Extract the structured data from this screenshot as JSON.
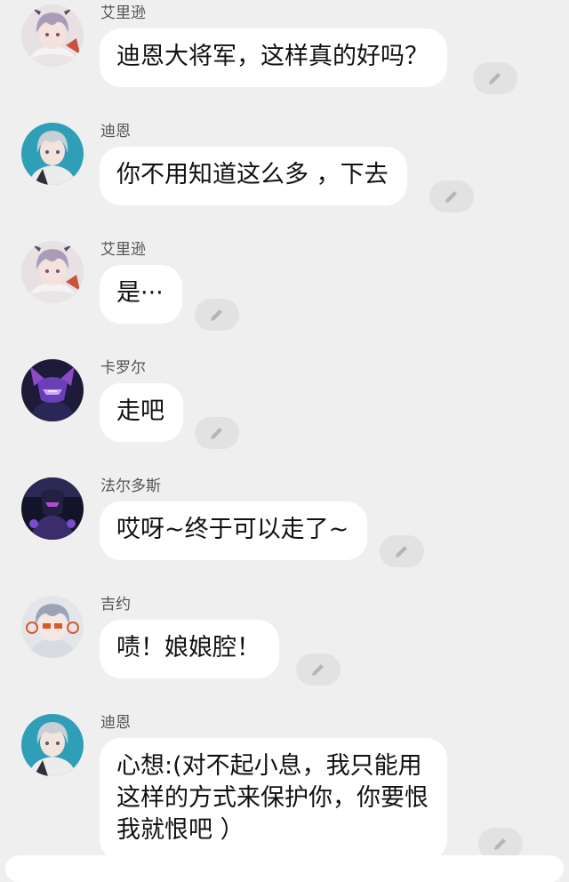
{
  "colors": {
    "background": "#efefef",
    "bubble": "#ffffff",
    "name_text": "#555555",
    "message_text": "#111111",
    "edit_button": "#e2e2e2",
    "edit_icon": "#b5b5b5"
  },
  "messages": [
    {
      "sender": "艾里逊",
      "avatar_icon": "ailixun-avatar",
      "lines": [
        "迪恩大将军，这样真的好吗？"
      ]
    },
    {
      "sender": "迪恩",
      "avatar_icon": "dien-avatar",
      "lines": [
        "你不用知道这么多 ，下去"
      ]
    },
    {
      "sender": "艾里逊",
      "avatar_icon": "ailixun-avatar",
      "lines": [
        "是···"
      ]
    },
    {
      "sender": "卡罗尔",
      "avatar_icon": "kaluoer-avatar",
      "lines": [
        "走吧"
      ]
    },
    {
      "sender": "法尔多斯",
      "avatar_icon": "faerduosi-avatar",
      "lines": [
        "哎呀~终于可以走了~"
      ]
    },
    {
      "sender": "吉约",
      "avatar_icon": "jiyue-avatar",
      "lines": [
        "啧！娘娘腔！"
      ]
    },
    {
      "sender": "迪恩",
      "avatar_icon": "dien-avatar",
      "lines": [
        "心想:(对不起小息，我只能用",
        "这样的方式来保护你，你要恨",
        "我就恨吧 ）"
      ]
    }
  ]
}
